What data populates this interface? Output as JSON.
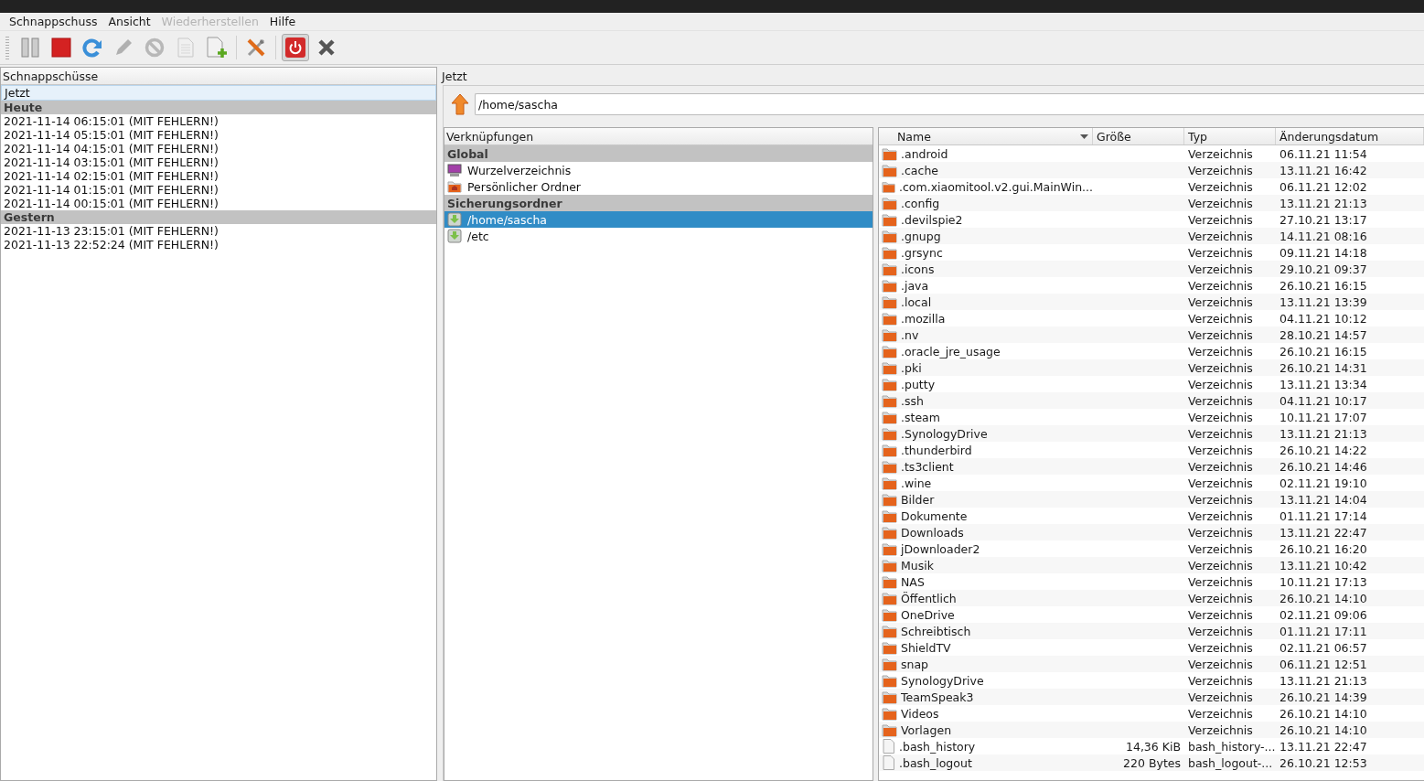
{
  "menu": [
    {
      "label": "Schnappschuss",
      "disabled": false
    },
    {
      "label": "Ansicht",
      "disabled": false
    },
    {
      "label": "Wiederherstellen",
      "disabled": true
    },
    {
      "label": "Hilfe",
      "disabled": false
    }
  ],
  "toolbar": [
    {
      "kind": "button",
      "disabled": false,
      "pressed": false
    },
    {
      "kind": "button",
      "disabled": false,
      "pressed": false
    },
    {
      "kind": "button",
      "disabled": false,
      "pressed": false
    },
    {
      "kind": "button",
      "disabled": true,
      "pressed": false
    },
    {
      "kind": "button",
      "disabled": true,
      "pressed": false
    },
    {
      "kind": "button",
      "disabled": true,
      "pressed": false
    },
    {
      "kind": "button",
      "disabled": false,
      "pressed": false
    },
    {
      "kind": "separator"
    },
    {
      "kind": "button",
      "disabled": false,
      "pressed": false
    },
    {
      "kind": "separator"
    },
    {
      "kind": "button",
      "disabled": false,
      "pressed": true
    },
    {
      "kind": "button",
      "disabled": false,
      "pressed": false
    }
  ],
  "snapshots": {
    "header": "Schnappschüsse",
    "items": [
      {
        "kind": "item",
        "label": "Jetzt",
        "selected": true
      },
      {
        "kind": "group",
        "label": "Heute"
      },
      {
        "kind": "item",
        "label": "2021-11-14 06:15:01 (MIT FEHLERN!)",
        "selected": false
      },
      {
        "kind": "item",
        "label": "2021-11-14 05:15:01 (MIT FEHLERN!)",
        "selected": false
      },
      {
        "kind": "item",
        "label": "2021-11-14 04:15:01 (MIT FEHLERN!)",
        "selected": false
      },
      {
        "kind": "item",
        "label": "2021-11-14 03:15:01 (MIT FEHLERN!)",
        "selected": false
      },
      {
        "kind": "item",
        "label": "2021-11-14 02:15:01 (MIT FEHLERN!)",
        "selected": false
      },
      {
        "kind": "item",
        "label": "2021-11-14 01:15:01 (MIT FEHLERN!)",
        "selected": false
      },
      {
        "kind": "item",
        "label": "2021-11-14 00:15:01 (MIT FEHLERN!)",
        "selected": false
      },
      {
        "kind": "group",
        "label": "Gestern"
      },
      {
        "kind": "item",
        "label": "2021-11-13 23:15:01 (MIT FEHLERN!)",
        "selected": false
      },
      {
        "kind": "item",
        "label": "2021-11-13 22:52:24 (MIT FEHLERN!)",
        "selected": false
      }
    ]
  },
  "browser": {
    "title": "Jetzt",
    "path": "/home/sascha",
    "shortcuts": {
      "header": "Verknüpfungen",
      "items": [
        {
          "kind": "group",
          "label": "Global"
        },
        {
          "kind": "system",
          "label": "Wurzelverzeichnis",
          "selected": false
        },
        {
          "kind": "home",
          "label": "Persönlicher Ordner",
          "selected": false
        },
        {
          "kind": "group",
          "label": "Sicherungsordner"
        },
        {
          "kind": "backup",
          "label": "/home/sascha",
          "selected": true
        },
        {
          "kind": "backup",
          "label": "/etc",
          "selected": false
        }
      ]
    },
    "files": {
      "columns": [
        {
          "label": "Name",
          "sorted": true
        },
        {
          "label": "Größe",
          "sorted": false
        },
        {
          "label": "Typ",
          "sorted": false
        },
        {
          "label": "Änderungsdatum",
          "sorted": false
        }
      ],
      "rows": [
        {
          "kind": "folder",
          "name": ".android",
          "type": "Verzeichnis",
          "date": "06.11.21 11:54"
        },
        {
          "kind": "folder",
          "name": ".cache",
          "type": "Verzeichnis",
          "date": "13.11.21 16:42"
        },
        {
          "kind": "folder",
          "name": ".com.xiaomitool.v2.gui.MainWin...",
          "type": "Verzeichnis",
          "date": "06.11.21 12:02"
        },
        {
          "kind": "folder",
          "name": ".config",
          "type": "Verzeichnis",
          "date": "13.11.21 21:13"
        },
        {
          "kind": "folder",
          "name": ".devilspie2",
          "type": "Verzeichnis",
          "date": "27.10.21 13:17"
        },
        {
          "kind": "folder",
          "name": ".gnupg",
          "type": "Verzeichnis",
          "date": "14.11.21 08:16"
        },
        {
          "kind": "folder",
          "name": ".grsync",
          "type": "Verzeichnis",
          "date": "09.11.21 14:18"
        },
        {
          "kind": "folder",
          "name": ".icons",
          "type": "Verzeichnis",
          "date": "29.10.21 09:37"
        },
        {
          "kind": "folder",
          "name": ".java",
          "type": "Verzeichnis",
          "date": "26.10.21 16:15"
        },
        {
          "kind": "folder",
          "name": ".local",
          "type": "Verzeichnis",
          "date": "13.11.21 13:39"
        },
        {
          "kind": "folder",
          "name": ".mozilla",
          "type": "Verzeichnis",
          "date": "04.11.21 10:12"
        },
        {
          "kind": "folder",
          "name": ".nv",
          "type": "Verzeichnis",
          "date": "28.10.21 14:57"
        },
        {
          "kind": "folder",
          "name": ".oracle_jre_usage",
          "type": "Verzeichnis",
          "date": "26.10.21 16:15"
        },
        {
          "kind": "folder",
          "name": ".pki",
          "type": "Verzeichnis",
          "date": "26.10.21 14:31"
        },
        {
          "kind": "folder",
          "name": ".putty",
          "type": "Verzeichnis",
          "date": "13.11.21 13:34"
        },
        {
          "kind": "folder",
          "name": ".ssh",
          "type": "Verzeichnis",
          "date": "04.11.21 10:17"
        },
        {
          "kind": "folder",
          "name": ".steam",
          "type": "Verzeichnis",
          "date": "10.11.21 17:07"
        },
        {
          "kind": "folder",
          "name": ".SynologyDrive",
          "type": "Verzeichnis",
          "date": "13.11.21 21:13"
        },
        {
          "kind": "folder",
          "name": ".thunderbird",
          "type": "Verzeichnis",
          "date": "26.10.21 14:22"
        },
        {
          "kind": "folder",
          "name": ".ts3client",
          "type": "Verzeichnis",
          "date": "26.10.21 14:46"
        },
        {
          "kind": "folder",
          "name": ".wine",
          "type": "Verzeichnis",
          "date": "02.11.21 19:10"
        },
        {
          "kind": "folder",
          "name": "Bilder",
          "type": "Verzeichnis",
          "date": "13.11.21 14:04"
        },
        {
          "kind": "folder",
          "name": "Dokumente",
          "type": "Verzeichnis",
          "date": "01.11.21 17:14"
        },
        {
          "kind": "folder",
          "name": "Downloads",
          "type": "Verzeichnis",
          "date": "13.11.21 22:47"
        },
        {
          "kind": "folder",
          "name": "jDownloader2",
          "type": "Verzeichnis",
          "date": "26.10.21 16:20"
        },
        {
          "kind": "folder",
          "name": "Musik",
          "type": "Verzeichnis",
          "date": "13.11.21 10:42"
        },
        {
          "kind": "folder",
          "name": "NAS",
          "type": "Verzeichnis",
          "date": "10.11.21 17:13"
        },
        {
          "kind": "folder",
          "name": "Öffentlich",
          "type": "Verzeichnis",
          "date": "26.10.21 14:10"
        },
        {
          "kind": "folder",
          "name": "OneDrive",
          "type": "Verzeichnis",
          "date": "02.11.21 09:06"
        },
        {
          "kind": "folder",
          "name": "Schreibtisch",
          "type": "Verzeichnis",
          "date": "01.11.21 17:11"
        },
        {
          "kind": "folder",
          "name": "ShieldTV",
          "type": "Verzeichnis",
          "date": "02.11.21 06:57"
        },
        {
          "kind": "folder",
          "name": "snap",
          "type": "Verzeichnis",
          "date": "06.11.21 12:51"
        },
        {
          "kind": "folder",
          "name": "SynologyDrive",
          "type": "Verzeichnis",
          "date": "13.11.21 21:13"
        },
        {
          "kind": "folder",
          "name": "TeamSpeak3",
          "type": "Verzeichnis",
          "date": "26.10.21 14:39"
        },
        {
          "kind": "folder",
          "name": "Videos",
          "type": "Verzeichnis",
          "date": "26.10.21 14:10"
        },
        {
          "kind": "folder",
          "name": "Vorlagen",
          "type": "Verzeichnis",
          "date": "26.10.21 14:10"
        },
        {
          "kind": "file",
          "name": ".bash_history",
          "size": "14,36 KiB",
          "type": "bash_history-...",
          "date": "13.11.21 22:47"
        },
        {
          "kind": "file",
          "name": ".bash_logout",
          "size": "220 Bytes",
          "type": "bash_logout-...",
          "date": "26.10.21 12:53"
        }
      ]
    }
  }
}
